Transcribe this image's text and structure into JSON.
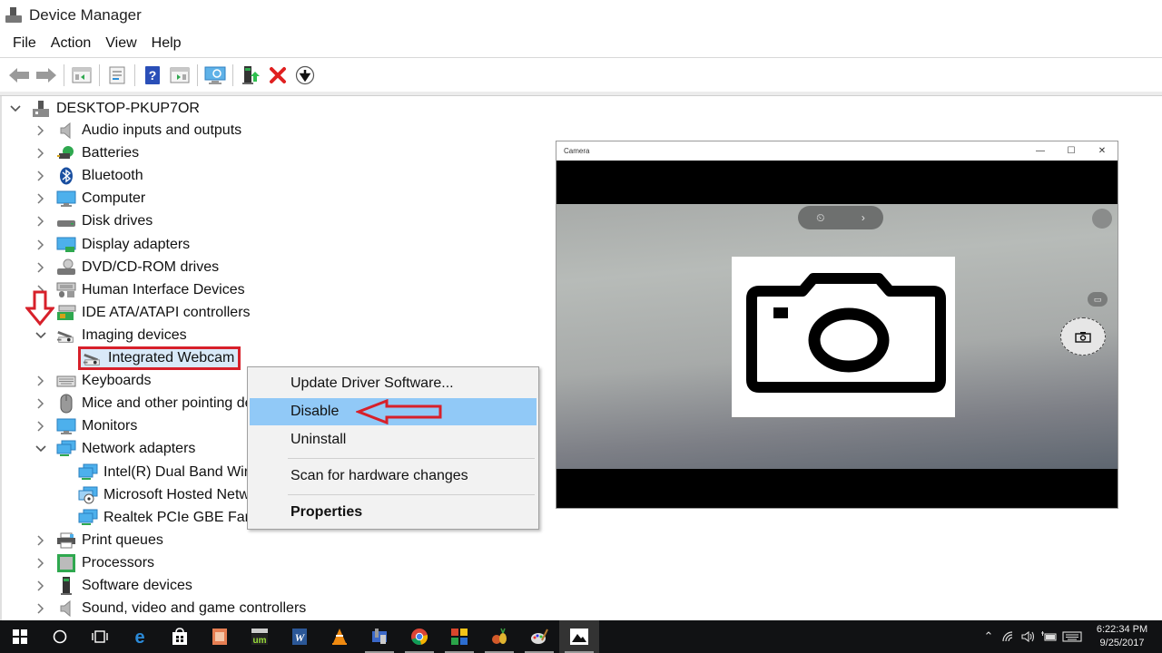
{
  "window": {
    "title": "Device Manager",
    "app_icon": "device-manager-icon"
  },
  "menu": [
    "File",
    "Action",
    "View",
    "Help"
  ],
  "toolbar": {
    "buttons": [
      {
        "name": "back",
        "icon": "arrow-left-icon"
      },
      {
        "name": "forward",
        "icon": "arrow-right-icon"
      },
      {
        "name": "show-hide-console-tree",
        "icon": "console-tree-icon"
      },
      {
        "name": "properties",
        "icon": "properties-icon"
      },
      {
        "name": "help",
        "icon": "help-icon"
      },
      {
        "name": "show-hide-action-pane",
        "icon": "action-pane-icon"
      },
      {
        "name": "scan-hardware",
        "icon": "scan-monitor-icon"
      },
      {
        "name": "update-driver",
        "icon": "update-driver-icon"
      },
      {
        "name": "uninstall",
        "icon": "red-x-icon"
      },
      {
        "name": "disable",
        "icon": "down-arrow-circle-icon"
      }
    ]
  },
  "tree": {
    "root": "DESKTOP-PKUP7OR",
    "items": [
      {
        "label": "Audio inputs and outputs",
        "icon": "speaker-icon",
        "expanded": false
      },
      {
        "label": "Batteries",
        "icon": "battery-icon",
        "expanded": false
      },
      {
        "label": "Bluetooth",
        "icon": "bluetooth-icon",
        "expanded": false
      },
      {
        "label": "Computer",
        "icon": "computer-icon",
        "expanded": false
      },
      {
        "label": "Disk drives",
        "icon": "disk-drive-icon",
        "expanded": false
      },
      {
        "label": "Display adapters",
        "icon": "display-adapter-icon",
        "expanded": false
      },
      {
        "label": "DVD/CD-ROM drives",
        "icon": "dvd-drive-icon",
        "expanded": false
      },
      {
        "label": "Human Interface Devices",
        "icon": "hid-icon",
        "expanded": false
      },
      {
        "label": "IDE ATA/ATAPI controllers",
        "icon": "ide-controller-icon",
        "expanded": false
      },
      {
        "label": "Imaging devices",
        "icon": "webcam-icon",
        "expanded": true
      },
      {
        "label": "Integrated Webcam",
        "icon": "webcam-icon",
        "child": true,
        "selected": true
      },
      {
        "label": "Keyboards",
        "icon": "keyboard-icon",
        "expanded": false
      },
      {
        "label": "Mice and other pointing devices",
        "icon": "mouse-icon",
        "expanded": false
      },
      {
        "label": "Monitors",
        "icon": "monitor-icon",
        "expanded": false
      },
      {
        "label": "Network adapters",
        "icon": "network-adapter-icon",
        "expanded": true
      },
      {
        "label": "Intel(R) Dual Band Wireless",
        "icon": "network-adapter-icon",
        "child": true
      },
      {
        "label": "Microsoft Hosted Network",
        "icon": "network-hosted-icon",
        "child": true
      },
      {
        "label": "Realtek PCIe GBE Family",
        "icon": "network-adapter-icon",
        "child": true
      },
      {
        "label": "Print queues",
        "icon": "printer-icon",
        "expanded": false
      },
      {
        "label": "Processors",
        "icon": "processor-icon",
        "expanded": false
      },
      {
        "label": "Software devices",
        "icon": "software-device-icon",
        "expanded": false
      },
      {
        "label": "Sound, video and game controllers",
        "icon": "speaker-icon",
        "expanded": false
      }
    ]
  },
  "context_menu": {
    "items": [
      {
        "label": "Update Driver Software...",
        "active": false,
        "bold": false
      },
      {
        "label": "Disable",
        "active": true,
        "bold": false
      },
      {
        "label": "Uninstall",
        "active": false,
        "bold": false
      },
      {
        "label": "Scan for hardware changes",
        "active": false,
        "bold": false
      },
      {
        "label": "Properties",
        "active": false,
        "bold": true
      }
    ]
  },
  "camera_window": {
    "title": "Camera",
    "controls": {
      "minimize": "—",
      "maximize": "☐",
      "close": "✕"
    },
    "pill_icons": [
      "timer-icon",
      "chevron-right-icon"
    ],
    "settings_icon": "gear-icon",
    "mode_toggle_icon": "video-icon",
    "shutter_icon": "camera-icon",
    "placeholder_icon": "camera-icon"
  },
  "taskbar": {
    "apps": [
      {
        "name": "start",
        "icon": "windows-logo-icon"
      },
      {
        "name": "cortana",
        "icon": "search-circle-icon"
      },
      {
        "name": "task-view",
        "icon": "task-view-icon"
      },
      {
        "name": "edge",
        "icon": "edge-icon"
      },
      {
        "name": "store",
        "icon": "store-icon"
      },
      {
        "name": "powerpoint",
        "icon": "powerpoint-icon"
      },
      {
        "name": "umplayer",
        "icon": "um-player-icon"
      },
      {
        "name": "word",
        "icon": "word-icon"
      },
      {
        "name": "vlc",
        "icon": "vlc-icon"
      },
      {
        "name": "device-manager",
        "icon": "device-manager-icon",
        "running": true
      },
      {
        "name": "chrome",
        "icon": "chrome-icon",
        "running": true
      },
      {
        "name": "app-tiles",
        "icon": "tiles-icon",
        "running": true
      },
      {
        "name": "fruit-app",
        "icon": "fruit-icon",
        "running": true
      },
      {
        "name": "paint",
        "icon": "paint-icon",
        "running": true
      },
      {
        "name": "photos",
        "icon": "photos-icon",
        "running": true,
        "active": true
      }
    ],
    "tray": {
      "icons": [
        "chevron-up-icon",
        "wifi-icon",
        "volume-icon",
        "battery-icon",
        "keyboard-icon"
      ],
      "time": "6:22:34 PM",
      "date": "9/25/2017"
    }
  },
  "annotations": {
    "arrow_color": "#d7202a",
    "highlight_color": "#d7202a"
  },
  "colors": {
    "menu_highlight": "#91c9f7",
    "selection": "#d9e9f8",
    "taskbar": "#111214"
  }
}
